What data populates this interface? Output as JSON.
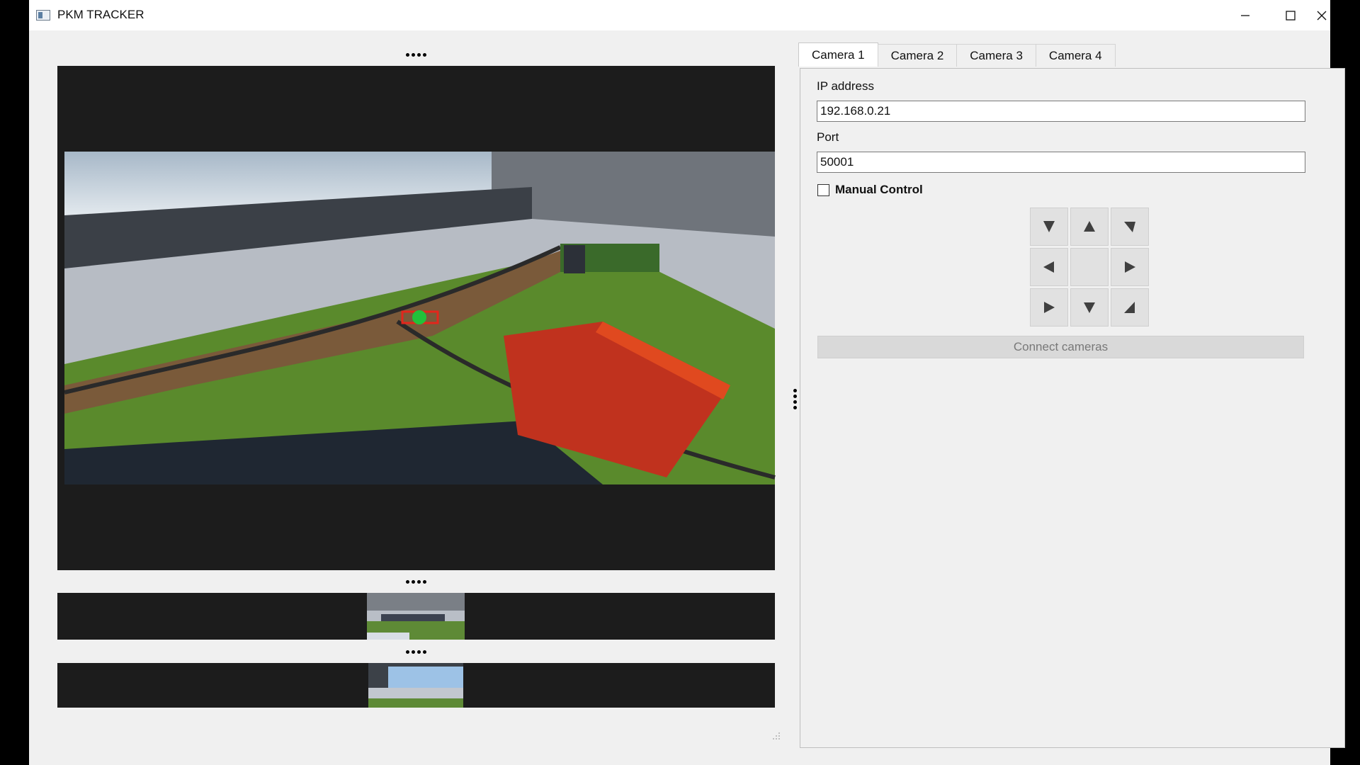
{
  "window": {
    "title": "PKM TRACKER",
    "controls": [
      "minimize-icon",
      "maximize-icon",
      "close-icon"
    ]
  },
  "video_panes": {
    "main_view": {
      "description_marker": "tracked-target"
    },
    "thumbnail_1": {},
    "thumbnail_2": {}
  },
  "tabs": [
    {
      "label": "Camera 1",
      "active": true
    },
    {
      "label": "Camera 2",
      "active": false
    },
    {
      "label": "Camera 3",
      "active": false
    },
    {
      "label": "Camera 4",
      "active": false
    }
  ],
  "camera_form": {
    "ip_label": "IP address",
    "ip_value": "192.168.0.21",
    "port_label": "Port",
    "port_value": "50001",
    "manual_control_label": "Manual Control",
    "manual_control_checked": false,
    "ptz_buttons": [
      "down-left-arrow-icon",
      "up-arrow-icon",
      "down-right-arrow-icon",
      "left-arrow-icon",
      "",
      "right-arrow-icon",
      "up-right-arrow-icon",
      "down-arrow-icon",
      "up-left-arrow-icon"
    ],
    "connect_label": "Connect cameras",
    "connect_enabled": false
  },
  "colors": {
    "video_background": "#1c1c1c",
    "tracking_box": "#e3261c",
    "tracking_dot": "#22c23a"
  }
}
